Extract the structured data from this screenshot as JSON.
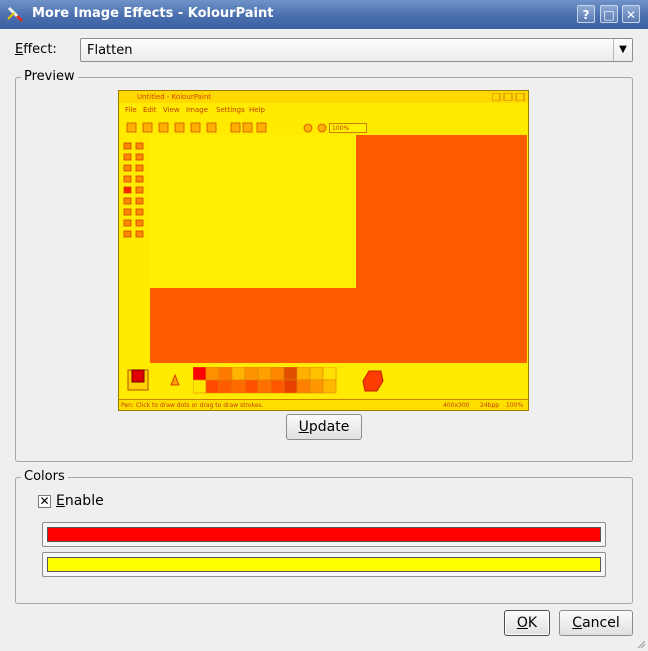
{
  "window": {
    "title": "More Image Effects - KolourPaint",
    "help_button": "?",
    "maximize_button": "□",
    "close_button": "✕"
  },
  "effect": {
    "label_prefix": "E",
    "label_rest": "ffect:",
    "selected": "Flatten"
  },
  "preview_group": {
    "title": "Preview",
    "update_label_prefix": "U",
    "update_label_rest": "pdate",
    "thumbnail": {
      "title": "Untitled - KolourPaint",
      "menu": [
        "File",
        "Edit",
        "View",
        "Image",
        "Settings",
        "Help"
      ],
      "zoom": "100%",
      "status_text": "Pen: Click to draw dots or drag to draw strokes.",
      "status_size": "400x300",
      "status_depth": "24bpp",
      "status_zoom": "100%"
    }
  },
  "colors_group": {
    "title": "Colors",
    "enable_label_prefix": "E",
    "enable_label_rest": "nable",
    "enable_checked": true,
    "color1": "#ff0000",
    "color2": "#ffff00"
  },
  "buttons": {
    "ok_prefix": "O",
    "ok_rest": "K",
    "cancel_prefix": "C",
    "cancel_rest": "ancel"
  },
  "colors": {
    "titlebar": "#4a6fae",
    "preview_bg": "#ff5b00",
    "preview_fg": "#ffef00"
  }
}
